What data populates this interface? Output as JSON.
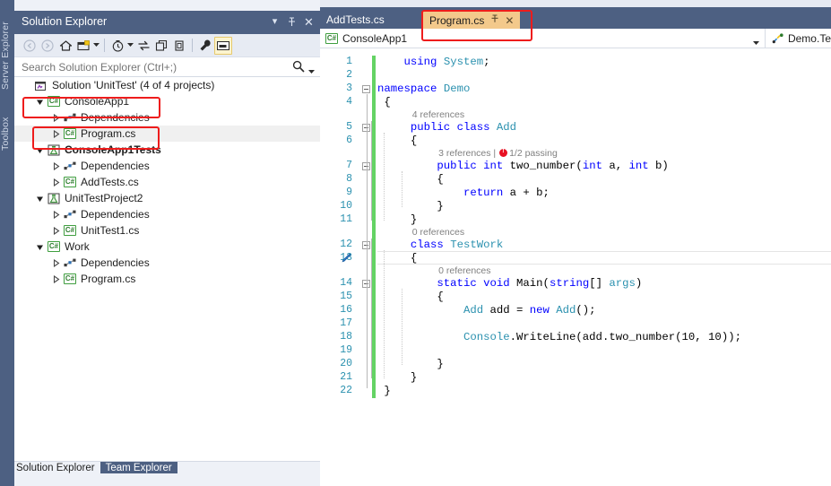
{
  "app": {
    "dock_tabs": [
      "Server Explorer",
      "Toolbox"
    ]
  },
  "solution_explorer": {
    "title": "Solution Explorer",
    "title_buttons": [
      "dropdown",
      "pin",
      "close"
    ],
    "toolbar_icons": [
      "back-icon",
      "forward-icon",
      "home-icon",
      "new-folder-icon",
      "dropdown-caret-icon",
      "pending-changes-icon",
      "dropdown-caret-icon",
      "sync-icon",
      "collapse-all-icon",
      "show-all-files-icon",
      "properties-icon",
      "preview-selected-items-icon"
    ],
    "search": {
      "placeholder": "Search Solution Explorer (Ctrl+;)",
      "value": ""
    },
    "tree": [
      {
        "label": "Solution 'UnitTest' (4 of 4 projects)",
        "icon": "solution-icon",
        "indent": 0,
        "expander": "none",
        "bold": false,
        "selected": false
      },
      {
        "label": "ConsoleApp1",
        "icon": "csharp-project-icon",
        "indent": 1,
        "expander": "expanded",
        "bold": false,
        "selected": false
      },
      {
        "label": "Dependencies",
        "icon": "dependencies-icon",
        "indent": 2,
        "expander": "collapsed",
        "bold": false,
        "selected": false
      },
      {
        "label": "Program.cs",
        "icon": "csharp-file-icon",
        "indent": 2,
        "expander": "collapsed",
        "bold": false,
        "selected": true
      },
      {
        "label": "ConsoleApp1Tests",
        "icon": "test-project-icon",
        "indent": 1,
        "expander": "expanded",
        "bold": true,
        "selected": false
      },
      {
        "label": "Dependencies",
        "icon": "dependencies-icon",
        "indent": 2,
        "expander": "collapsed",
        "bold": false,
        "selected": false
      },
      {
        "label": "AddTests.cs",
        "icon": "csharp-file-icon",
        "indent": 2,
        "expander": "collapsed",
        "bold": false,
        "selected": false
      },
      {
        "label": "UnitTestProject2",
        "icon": "test-project-icon",
        "indent": 1,
        "expander": "expanded",
        "bold": false,
        "selected": false
      },
      {
        "label": "Dependencies",
        "icon": "dependencies-icon",
        "indent": 2,
        "expander": "collapsed",
        "bold": false,
        "selected": false
      },
      {
        "label": "UnitTest1.cs",
        "icon": "csharp-file-icon",
        "indent": 2,
        "expander": "collapsed",
        "bold": false,
        "selected": false
      },
      {
        "label": "Work",
        "icon": "csharp-project-icon",
        "indent": 1,
        "expander": "expanded",
        "bold": false,
        "selected": false
      },
      {
        "label": "Dependencies",
        "icon": "dependencies-icon",
        "indent": 2,
        "expander": "collapsed",
        "bold": false,
        "selected": false
      },
      {
        "label": "Program.cs",
        "icon": "csharp-file-icon",
        "indent": 2,
        "expander": "collapsed",
        "bold": false,
        "selected": false
      }
    ],
    "footer_tabs": [
      {
        "label": "Solution Explorer",
        "active": false
      },
      {
        "label": "Team Explorer",
        "active": true
      }
    ]
  },
  "editor": {
    "tabs": [
      {
        "label": "AddTests.cs",
        "active": false
      },
      {
        "label": "Program.cs",
        "active": true,
        "pin_icon": "pin-icon",
        "close_icon": "close-icon"
      }
    ],
    "navbar": {
      "project": "ConsoleApp1",
      "project_icon": "csharp-project-icon",
      "dropdown_icon": "chevron-down-icon",
      "right_item": "Demo.Te",
      "right_item_icon": "members-icon"
    },
    "lines": [
      {
        "n": 1,
        "text": "    using System;"
      },
      {
        "n": 2,
        "text": ""
      },
      {
        "n": 3,
        "text": "namespace Demo"
      },
      {
        "n": 4,
        "text": " {"
      },
      {
        "n": 5,
        "text": "     public class Add"
      },
      {
        "n": 6,
        "text": "     {"
      },
      {
        "n": 7,
        "text": "         public int two_number(int a, int b)"
      },
      {
        "n": 8,
        "text": "         {"
      },
      {
        "n": 9,
        "text": "             return a + b;"
      },
      {
        "n": 10,
        "text": "         }"
      },
      {
        "n": 11,
        "text": "     }"
      },
      {
        "n": 12,
        "text": "     class TestWork"
      },
      {
        "n": 13,
        "text": "     {"
      },
      {
        "n": 14,
        "text": "         static void Main(string[] args)"
      },
      {
        "n": 15,
        "text": "         {"
      },
      {
        "n": 16,
        "text": "             Add add = new Add();"
      },
      {
        "n": 17,
        "text": ""
      },
      {
        "n": 18,
        "text": "             Console.WriteLine(add.two_number(10, 10));"
      },
      {
        "n": 19,
        "text": ""
      },
      {
        "n": 20,
        "text": "         }"
      },
      {
        "n": 21,
        "text": "     }"
      },
      {
        "n": 22,
        "text": " }"
      }
    ],
    "codelens": [
      {
        "above_line": 5,
        "text": "4 references",
        "has_test": false
      },
      {
        "above_line": 7,
        "text": "3 references",
        "has_test": true,
        "test_text": "1/2 passing",
        "separator": "|"
      },
      {
        "above_line": 12,
        "text": "0 references",
        "has_test": false
      },
      {
        "above_line": 14,
        "text": "0 references",
        "has_test": false
      }
    ],
    "current_line": 13,
    "edit_marker_line": 13,
    "edit_marker_icon": "pencil-icon"
  },
  "annotations": {
    "boxes": [
      "project-consoleapp1-highlight",
      "program-cs-node-highlight",
      "program-cs-tab-highlight"
    ]
  },
  "colors": {
    "chrome": "#4d6082",
    "active_tab": "#f3c98b",
    "annotation": "#ee1c1c",
    "keyword": "#0000ff",
    "type": "#2b91af",
    "changebar_saved": "#64d364",
    "codelens_text": "#808080",
    "test_fail": "#e81123"
  }
}
